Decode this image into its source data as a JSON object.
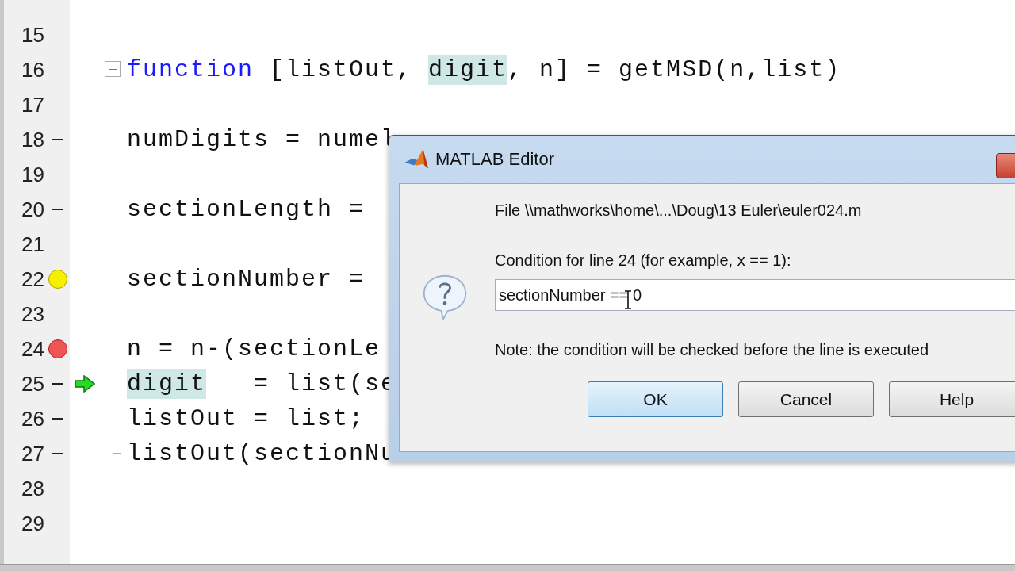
{
  "editor": {
    "lines": [
      {
        "number": "15",
        "current": false
      },
      {
        "number": "16",
        "current": false,
        "tokens": [
          {
            "text": "function",
            "kind": "keyword"
          },
          {
            "text": " [listOut, ",
            "kind": "plain"
          },
          {
            "text": "digit",
            "kind": "highlight"
          },
          {
            "text": ", n] = getMSD(n,list)",
            "kind": "plain"
          }
        ],
        "children": [
          {
            "number": "17",
            "current": false
          },
          {
            "number": "18",
            "kind": "executable",
            "current": false,
            "tokens": [
              {
                "text": "numDigits = numel",
                "kind": "plain"
              }
            ]
          },
          {
            "number": "19",
            "current": false
          },
          {
            "number": "20",
            "kind": "executable",
            "current": false,
            "tokens": [
              {
                "text": "sectionLength =",
                "kind": "plain"
              }
            ]
          },
          {
            "number": "21",
            "current": false
          },
          {
            "number": "22",
            "kind": "conditional-breakpoint",
            "current": false,
            "tokens": [
              {
                "text": "sectionNumber =",
                "kind": "plain"
              }
            ]
          },
          {
            "number": "23",
            "current": false
          },
          {
            "number": "24",
            "kind": "breakpoint",
            "current": false,
            "tokens": [
              {
                "text": "n = n-(sectionLe",
                "kind": "plain"
              }
            ]
          },
          {
            "number": "25",
            "kind": "executable",
            "current": true,
            "tokens": [
              {
                "text": "digit",
                "kind": "highlight"
              },
              {
                "text": "   = list(se",
                "kind": "plain"
              }
            ]
          },
          {
            "number": "26",
            "kind": "executable",
            "current": false,
            "tokens": [
              {
                "text": "listOut = list;",
                "kind": "plain"
              }
            ]
          },
          {
            "number": "27",
            "kind": "executable",
            "current": false,
            "tokens": [
              {
                "text": "listOut(sectionNu",
                "kind": "plain"
              }
            ]
          }
        ]
      },
      {
        "number": "28",
        "current": false
      },
      {
        "number": "29",
        "current": false
      }
    ]
  },
  "dialog": {
    "title": "MATLAB Editor",
    "file": "File \\\\mathworks\\home\\...\\Doug\\13 Euler\\euler024.m",
    "prompt": "Condition for line 24 (for example, x == 1):",
    "value": "sectionNumber == 0",
    "note": "Note: the condition will be checked before the line is executed",
    "buttons": [
      {
        "label": "OK",
        "default": true
      },
      {
        "label": "Cancel",
        "default": false
      },
      {
        "label": "Help",
        "default": false
      }
    ]
  }
}
